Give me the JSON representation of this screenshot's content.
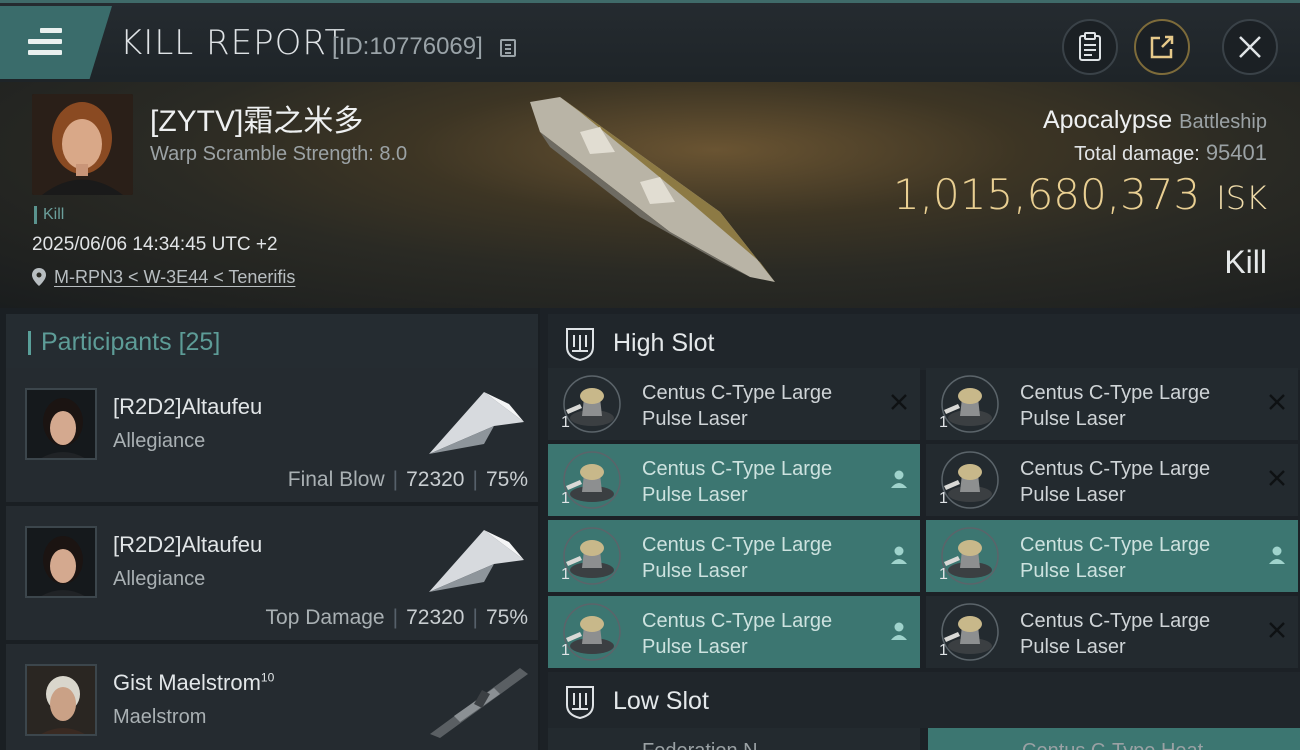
{
  "header": {
    "title": "KILL REPORT",
    "report_id": "[ID:10776069]"
  },
  "victim": {
    "name": "[ZYTV]霜之米多",
    "warp_scramble": "Warp Scramble Strength: 8.0",
    "tag": "Kill",
    "datetime": "2025/06/06 14:34:45 UTC +2",
    "location": "M-RPN3 < W-3E44 < Tenerifis",
    "ship_name": "Apocalypse",
    "ship_class": "Battleship",
    "total_damage_label": "Total damage:",
    "total_damage_value": "95401",
    "isk_value": "1,015,680,373",
    "isk_unit": "ISK",
    "result": "Kill"
  },
  "participants": {
    "label": "Participants",
    "count": "[25]",
    "items": [
      {
        "name": "[R2D2]Altaufeu",
        "ship": "Allegiance",
        "role": "Final Blow",
        "damage": "72320",
        "percent": "75%"
      },
      {
        "name": "[R2D2]Altaufeu",
        "ship": "Allegiance",
        "role": "Top Damage",
        "damage": "72320",
        "percent": "75%"
      },
      {
        "name": "Gist Maelstrom",
        "name_sup": "10",
        "ship": "Maelstrom"
      }
    ]
  },
  "fitting": {
    "high_slot_label": "High Slot",
    "low_slot_label": "Low Slot",
    "high_slot": [
      {
        "line1": "Centus C-Type Large",
        "line2": "Pulse Laser",
        "qty": "1",
        "state": "destroyed"
      },
      {
        "line1": "Centus C-Type Large",
        "line2": "Pulse Laser",
        "qty": "1",
        "state": "destroyed"
      },
      {
        "line1": "Centus C-Type Large",
        "line2": "Pulse Laser",
        "qty": "1",
        "state": "dropped"
      },
      {
        "line1": "Centus C-Type Large",
        "line2": "Pulse Laser",
        "qty": "1",
        "state": "destroyed"
      },
      {
        "line1": "Centus C-Type Large",
        "line2": "Pulse Laser",
        "qty": "1",
        "state": "dropped"
      },
      {
        "line1": "Centus C-Type Large",
        "line2": "Pulse Laser",
        "qty": "1",
        "state": "dropped"
      },
      {
        "line1": "Centus C-Type Large",
        "line2": "Pulse Laser",
        "qty": "1",
        "state": "dropped"
      },
      {
        "line1": "Centus C-Type Large",
        "line2": "Pulse Laser",
        "qty": "1",
        "state": "destroyed"
      }
    ],
    "low_slot_peek": [
      "Federation N...",
      "Centus C-Type Heat..."
    ]
  },
  "icons": {
    "menu": "menu-icon",
    "copy": "copy-icon",
    "clipboard": "clipboard-icon",
    "share": "share-icon",
    "close": "close-icon",
    "location": "pin-icon",
    "destroyed": "x-icon",
    "dropped": "person-icon"
  },
  "colors": {
    "accent_teal": "#3c7671",
    "isk_gold": "#e9cf92",
    "background": "#14181c"
  }
}
